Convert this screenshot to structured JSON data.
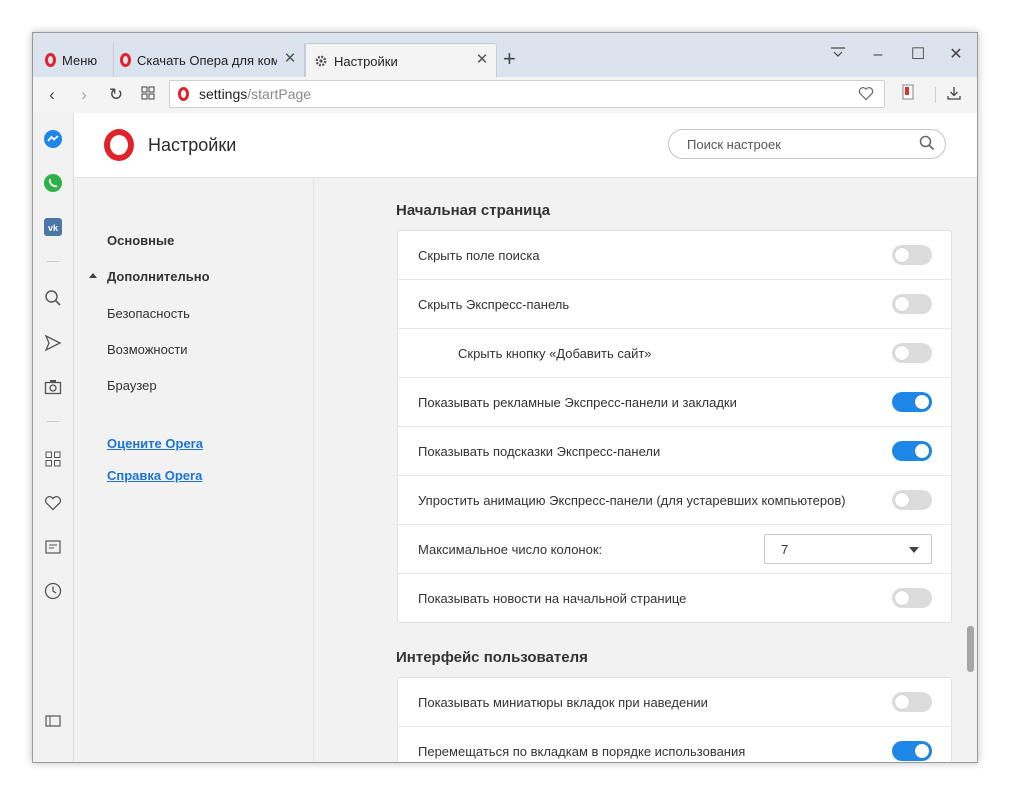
{
  "tabs": {
    "menu_label": "Меню",
    "tab1_label": "Скачать Опера для компьютера",
    "tab2_label": "Настройки",
    "new_tab": "+"
  },
  "address": {
    "host": "settings",
    "path": "/startPage"
  },
  "header": {
    "title": "Настройки",
    "search_placeholder": "Поиск настроек"
  },
  "nav": {
    "basic": "Основные",
    "advanced": "Дополнительно",
    "security": "Безопасность",
    "features": "Возможности",
    "browser": "Браузер",
    "rate": "Оцените Opera",
    "help": "Справка Opera"
  },
  "sections": {
    "start_page": {
      "title": "Начальная страница",
      "rows": [
        {
          "label": "Скрыть поле поиска",
          "on": false
        },
        {
          "label": "Скрыть Экспресс-панель",
          "on": false
        },
        {
          "label": "Скрыть кнопку «Добавить сайт»",
          "on": false,
          "indent": true
        },
        {
          "label": "Показывать рекламные Экспресс-панели и закладки",
          "on": true
        },
        {
          "label": "Показывать подсказки Экспресс-панели",
          "on": true
        },
        {
          "label": "Упростить анимацию Экспресс-панели (для устаревших компьютеров)",
          "on": false
        },
        {
          "label": "Максимальное число колонок:",
          "select_value": "7"
        },
        {
          "label": "Показывать новости на начальной странице",
          "on": false
        }
      ]
    },
    "ui": {
      "title": "Интерфейс пользователя",
      "rows": [
        {
          "label": "Показывать миниатюры вкладок при наведении",
          "on": false
        },
        {
          "label": "Перемещаться по вкладкам в порядке использования",
          "on": true
        }
      ]
    }
  },
  "colors": {
    "accent": "#1e86e6",
    "opera_red": "#e0222a",
    "link": "#1e74d0"
  }
}
